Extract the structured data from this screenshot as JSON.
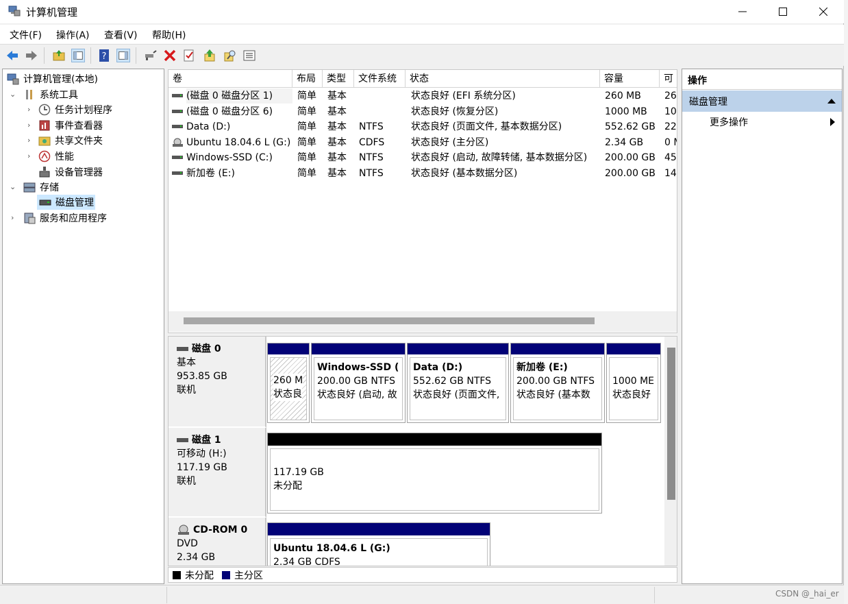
{
  "window": {
    "title": "计算机管理"
  },
  "menu": [
    "文件(F)",
    "操作(A)",
    "查看(V)",
    "帮助(H)"
  ],
  "tree": {
    "root": "计算机管理(本地)",
    "system_tools": "系统工具",
    "task_scheduler": "任务计划程序",
    "event_viewer": "事件查看器",
    "shared_folders": "共享文件夹",
    "performance": "性能",
    "device_manager": "设备管理器",
    "storage": "存储",
    "disk_management": "磁盘管理",
    "services": "服务和应用程序"
  },
  "volume_table": {
    "columns": [
      "卷",
      "布局",
      "类型",
      "文件系统",
      "状态",
      "容量",
      "可"
    ],
    "rows": [
      {
        "name": "(磁盘 0 磁盘分区 1)",
        "layout": "简单",
        "type": "基本",
        "fs": "",
        "status": "状态良好 (EFI 系统分区)",
        "capacity": "260 MB",
        "free": "26"
      },
      {
        "name": "(磁盘 0 磁盘分区 6)",
        "layout": "简单",
        "type": "基本",
        "fs": "",
        "status": "状态良好 (恢复分区)",
        "capacity": "1000 MB",
        "free": "10"
      },
      {
        "name": "Data (D:)",
        "layout": "简单",
        "type": "基本",
        "fs": "NTFS",
        "status": "状态良好 (页面文件, 基本数据分区)",
        "capacity": "552.62 GB",
        "free": "22"
      },
      {
        "name": "Ubuntu 18.04.6 L (G:)",
        "layout": "简单",
        "type": "基本",
        "fs": "CDFS",
        "status": "状态良好 (主分区)",
        "capacity": "2.34 GB",
        "free": "0 M"
      },
      {
        "name": "Windows-SSD (C:)",
        "layout": "简单",
        "type": "基本",
        "fs": "NTFS",
        "status": "状态良好 (启动, 故障转储, 基本数据分区)",
        "capacity": "200.00 GB",
        "free": "45"
      },
      {
        "name": "新加卷 (E:)",
        "layout": "简单",
        "type": "基本",
        "fs": "NTFS",
        "status": "状态良好 (基本数据分区)",
        "capacity": "200.00 GB",
        "free": "14"
      }
    ]
  },
  "disks": {
    "disk0": {
      "name": "磁盘 0",
      "type": "基本",
      "size": "953.85 GB",
      "state": "联机",
      "parts": [
        {
          "title": "",
          "line1": "260 M",
          "line2": "状态良"
        },
        {
          "title": "Windows-SSD  (",
          "line1": "200.00 GB NTFS",
          "line2": "状态良好 (启动, 故"
        },
        {
          "title": "Data  (D:)",
          "line1": "552.62 GB NTFS",
          "line2": "状态良好 (页面文件,"
        },
        {
          "title": "新加卷  (E:)",
          "line1": "200.00 GB NTFS",
          "line2": "状态良好 (基本数"
        },
        {
          "title": "",
          "line1": "1000 ME",
          "line2": "状态良好"
        }
      ]
    },
    "disk1": {
      "name": "磁盘 1",
      "type": "可移动 (H:)",
      "size": "117.19 GB",
      "state": "联机",
      "part": {
        "line1": "117.19 GB",
        "line2": "未分配"
      }
    },
    "cdrom0": {
      "name": "CD-ROM 0",
      "type": "DVD",
      "size": "2.34 GB",
      "part": {
        "title": "Ubuntu 18.04.6 L  (G:)",
        "line1": "2.34 GB CDFS"
      }
    }
  },
  "legend": {
    "unallocated": "未分配",
    "primary": "主分区"
  },
  "actions": {
    "header": "操作",
    "section": "磁盘管理",
    "more": "更多操作"
  },
  "watermark": "CSDN @_hai_er",
  "colors": {
    "primary": "#020277",
    "unallocated": "#000000",
    "selection": "#cce8ff",
    "actions_section": "#bcd2ea"
  }
}
